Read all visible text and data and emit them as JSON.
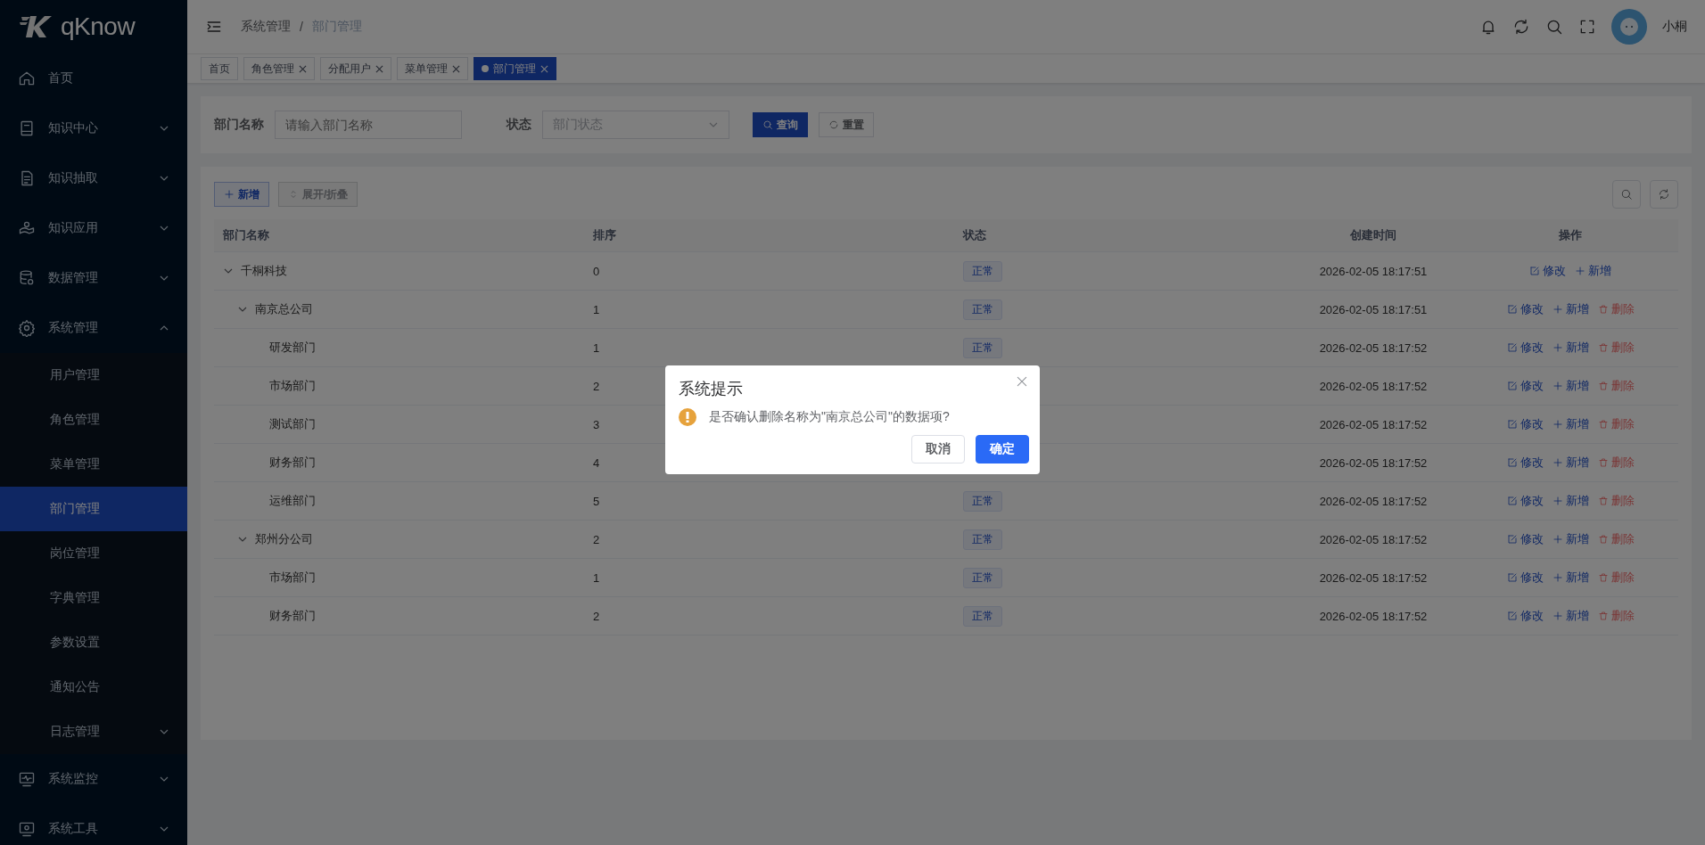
{
  "sidebar": {
    "logo": "qKnow",
    "items": [
      {
        "label": "首页",
        "selected": false
      },
      {
        "label": "知识中心",
        "expanded": false,
        "selected": false
      },
      {
        "label": "知识抽取",
        "expanded": false,
        "selected": false
      },
      {
        "label": "知识应用",
        "expanded": false,
        "selected": false
      },
      {
        "label": "数据管理",
        "expanded": false,
        "selected": false
      },
      {
        "label": "系统管理",
        "expanded": true,
        "selected": false,
        "children": [
          {
            "label": "用户管理",
            "selected": false
          },
          {
            "label": "角色管理",
            "selected": false
          },
          {
            "label": "菜单管理",
            "selected": false
          },
          {
            "label": "部门管理",
            "selected": true
          },
          {
            "label": "岗位管理",
            "selected": false
          },
          {
            "label": "字典管理",
            "selected": false
          },
          {
            "label": "参数设置",
            "selected": false
          },
          {
            "label": "通知公告",
            "selected": false
          },
          {
            "label": "日志管理",
            "selected": false,
            "expanded": false
          }
        ]
      },
      {
        "label": "系统监控",
        "expanded": false,
        "selected": false
      },
      {
        "label": "系统工具",
        "expanded": false,
        "selected": false
      }
    ]
  },
  "header": {
    "breadcrumb": [
      "系统管理",
      "部门管理"
    ],
    "separator": "/",
    "user_name": "小桐"
  },
  "tabs": [
    {
      "label": "首页",
      "selected": false,
      "closable": false
    },
    {
      "label": "角色管理",
      "selected": false,
      "closable": true
    },
    {
      "label": "分配用户",
      "selected": false,
      "closable": true
    },
    {
      "label": "菜单管理",
      "selected": false,
      "closable": true
    },
    {
      "label": "部门管理",
      "selected": true,
      "closable": true
    }
  ],
  "search_form": {
    "name_label": "部门名称",
    "name_placeholder": "请输入部门名称",
    "status_label": "状态",
    "status_placeholder": "部门状态",
    "search_button": "查询",
    "reset_button": "重置"
  },
  "toolbar": {
    "add_button": "新增",
    "toggle_button": "展开/折叠"
  },
  "table": {
    "columns": [
      "部门名称",
      "排序",
      "状态",
      "创建时间",
      "操作"
    ],
    "rows": [
      {
        "name": "千桐科技",
        "order": "0",
        "status": "正常",
        "created": "2026-02-05 18:17:51",
        "expanded": true,
        "actions": [
          {
            "kind": "edit",
            "label": "修改"
          },
          {
            "kind": "add",
            "label": "新增"
          }
        ],
        "children": [
          {
            "name": "南京总公司",
            "order": "1",
            "status": "正常",
            "created": "2026-02-05 18:17:51",
            "expanded": true,
            "actions": [
              {
                "kind": "edit",
                "label": "修改"
              },
              {
                "kind": "add",
                "label": "新增"
              },
              {
                "kind": "delete",
                "label": "删除"
              }
            ],
            "children": [
              {
                "name": "研发部门",
                "order": "1",
                "status": "正常",
                "created": "2026-02-05 18:17:52",
                "actions": [
                  {
                    "kind": "edit",
                    "label": "修改"
                  },
                  {
                    "kind": "add",
                    "label": "新增"
                  },
                  {
                    "kind": "delete",
                    "label": "删除"
                  }
                ]
              },
              {
                "name": "市场部门",
                "order": "2",
                "created": "2026-02-05 18:17:52",
                "actions": [
                  {
                    "kind": "edit",
                    "label": "修改"
                  },
                  {
                    "kind": "add",
                    "label": "新增"
                  },
                  {
                    "kind": "delete",
                    "label": "删除"
                  }
                ]
              },
              {
                "name": "测试部门",
                "order": "3",
                "created": "2026-02-05 18:17:52",
                "actions": [
                  {
                    "kind": "edit",
                    "label": "修改"
                  },
                  {
                    "kind": "add",
                    "label": "新增"
                  },
                  {
                    "kind": "delete",
                    "label": "删除"
                  }
                ]
              },
              {
                "name": "财务部门",
                "order": "4",
                "created": "2026-02-05 18:17:52",
                "actions": [
                  {
                    "kind": "edit",
                    "label": "修改"
                  },
                  {
                    "kind": "add",
                    "label": "新增"
                  },
                  {
                    "kind": "delete",
                    "label": "删除"
                  }
                ]
              },
              {
                "name": "运维部门",
                "order": "5",
                "status": "正常",
                "created": "2026-02-05 18:17:52",
                "actions": [
                  {
                    "kind": "edit",
                    "label": "修改"
                  },
                  {
                    "kind": "add",
                    "label": "新增"
                  },
                  {
                    "kind": "delete",
                    "label": "删除"
                  }
                ]
              }
            ]
          },
          {
            "name": "郑州分公司",
            "order": "2",
            "status": "正常",
            "created": "2026-02-05 18:17:52",
            "expanded": true,
            "actions": [
              {
                "kind": "edit",
                "label": "修改"
              },
              {
                "kind": "add",
                "label": "新增"
              },
              {
                "kind": "delete",
                "label": "删除"
              }
            ],
            "children": [
              {
                "name": "市场部门",
                "order": "1",
                "status": "正常",
                "created": "2026-02-05 18:17:52",
                "actions": [
                  {
                    "kind": "edit",
                    "label": "修改"
                  },
                  {
                    "kind": "add",
                    "label": "新增"
                  },
                  {
                    "kind": "delete",
                    "label": "删除"
                  }
                ]
              },
              {
                "name": "财务部门",
                "order": "2",
                "status": "正常",
                "created": "2026-02-05 18:17:52",
                "actions": [
                  {
                    "kind": "edit",
                    "label": "修改"
                  },
                  {
                    "kind": "add",
                    "label": "新增"
                  },
                  {
                    "kind": "delete",
                    "label": "删除"
                  }
                ]
              }
            ]
          }
        ]
      }
    ]
  },
  "dialog": {
    "title": "系统提示",
    "message": "是否确认删除名称为\"南京总公司\"的数据项?",
    "cancel_button": "取消",
    "confirm_button": "确定"
  }
}
